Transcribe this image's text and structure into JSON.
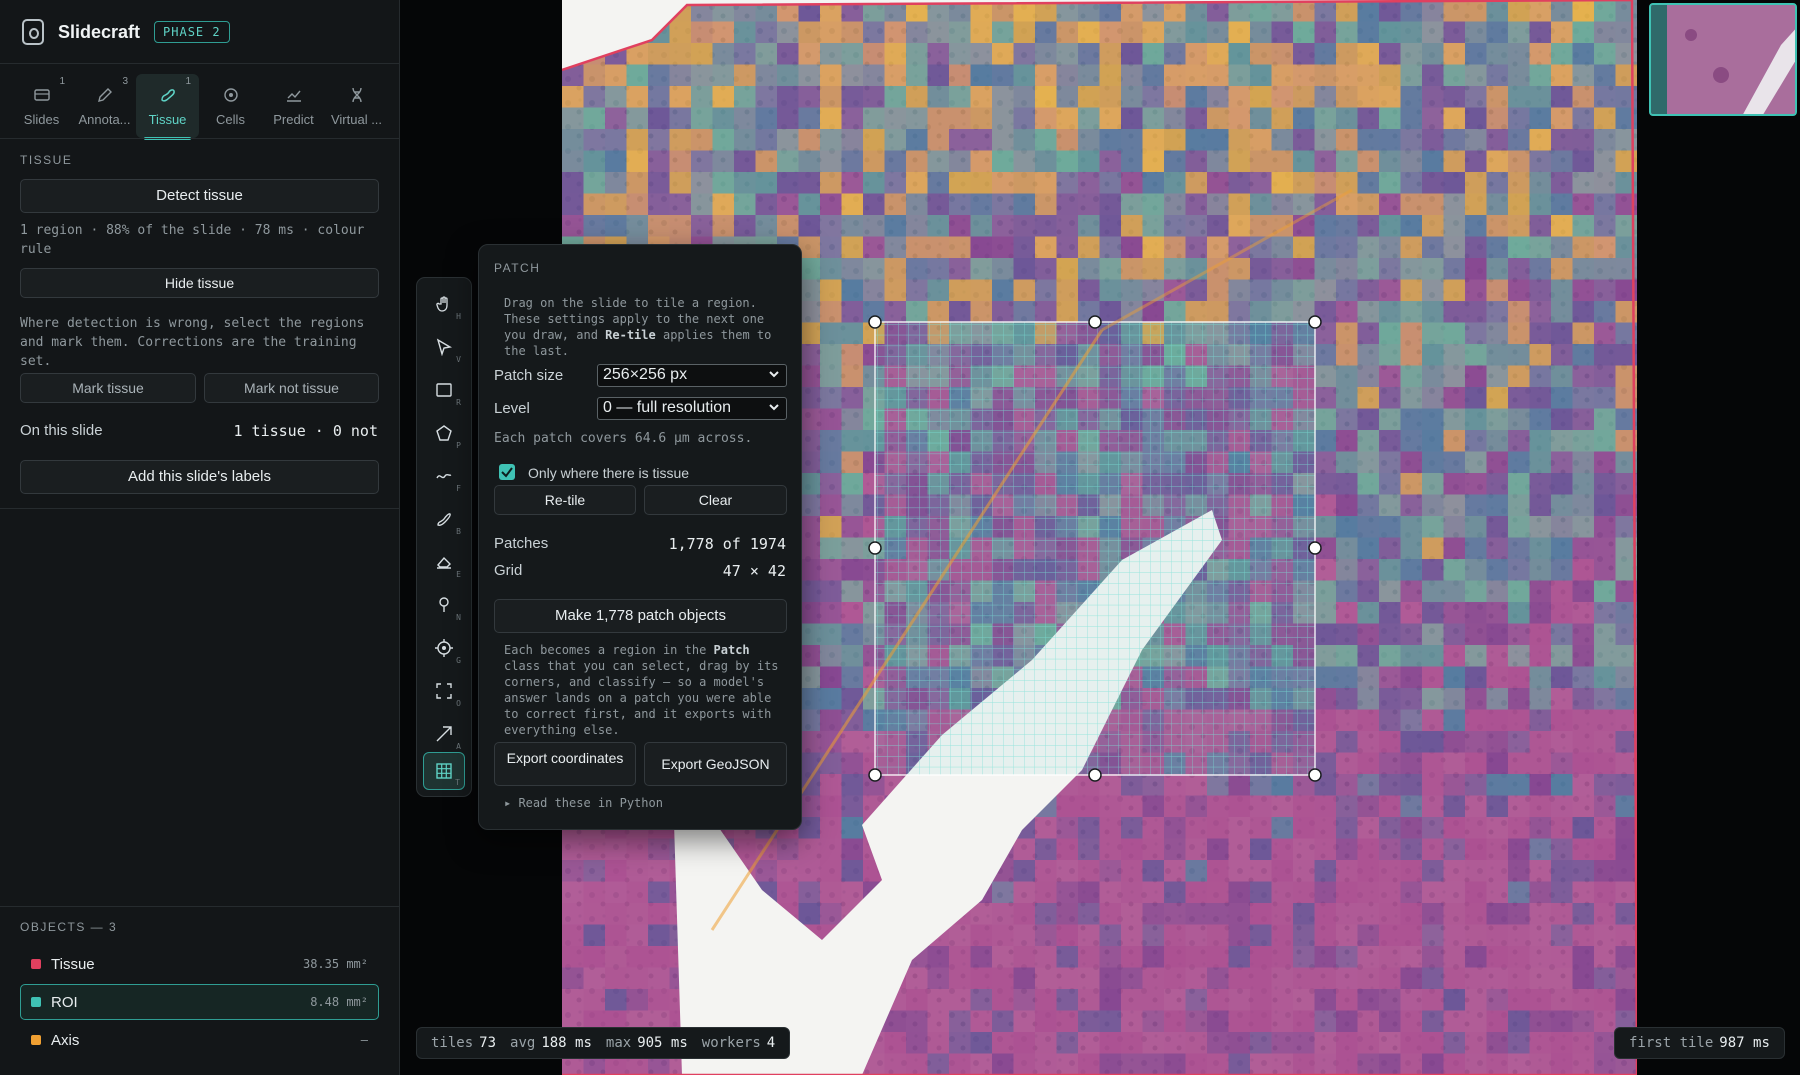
{
  "app": {
    "name": "Slidecraft",
    "phase": "PHASE 2"
  },
  "tabs": [
    {
      "label": "Slides",
      "badge": "1",
      "icon": "slides-icon"
    },
    {
      "label": "Annota...",
      "badge": "3",
      "icon": "pen-icon"
    },
    {
      "label": "Tissue",
      "badge": "1",
      "icon": "tissue-icon",
      "active": true
    },
    {
      "label": "Cells",
      "badge": "",
      "icon": "cell-icon"
    },
    {
      "label": "Predict",
      "badge": "",
      "icon": "chart-icon"
    },
    {
      "label": "Virtual ...",
      "badge": "",
      "icon": "dna-icon"
    }
  ],
  "tissue": {
    "section": "TISSUE",
    "detect_label": "Detect tissue",
    "summary": "1 region · 88% of the slide · 78 ms · colour rule",
    "hide_label": "Hide tissue",
    "help": "Where detection is wrong, select the regions and mark them. Corrections are the training set.",
    "mark_tissue": "Mark tissue",
    "mark_not_tissue": "Mark not tissue",
    "on_slide_label": "On this slide",
    "on_slide_value": "1 tissue · 0 not",
    "add_labels": "Add this slide's labels"
  },
  "objects": {
    "header": "OBJECTS — 3",
    "items": [
      {
        "name": "Tissue",
        "value": "38.35 mm²",
        "color": "#e0405f"
      },
      {
        "name": "ROI",
        "value": "8.48 mm²",
        "color": "#3fc2b4",
        "selected": true
      },
      {
        "name": "Axis",
        "value": "—",
        "color": "#f0a032"
      }
    ]
  },
  "tools": [
    {
      "name": "hand-icon",
      "key": "H"
    },
    {
      "name": "pointer-icon",
      "key": "V"
    },
    {
      "name": "rectangle-icon",
      "key": "R"
    },
    {
      "name": "polygon-icon",
      "key": "P"
    },
    {
      "name": "freehand-icon",
      "key": "F"
    },
    {
      "name": "brush-icon",
      "key": "B"
    },
    {
      "name": "eraser-icon",
      "key": "E"
    },
    {
      "name": "pin-icon",
      "key": "N"
    },
    {
      "name": "crosshair-icon",
      "key": "G"
    },
    {
      "name": "frame-icon",
      "key": "O"
    },
    {
      "name": "arrow-icon",
      "key": "A"
    },
    {
      "name": "grid-icon",
      "key": "T",
      "active": true
    }
  ],
  "patch": {
    "section": "PATCH",
    "intro_1": "Drag on the slide to tile a region. These settings apply to the next one you draw, and",
    "intro_bold": "Re-tile",
    "intro_2": "applies them to the last.",
    "patch_size_label": "Patch size",
    "patch_size_value": "256×256 px",
    "level_label": "Level",
    "level_value": "0 — full resolution",
    "covers": "Each patch covers 64.6 µm across.",
    "only_tissue_label": "Only where there is tissue",
    "retile_label": "Re-tile",
    "clear_label": "Clear",
    "patches_label": "Patches",
    "patches_value": "1,778 of 1974",
    "grid_label": "Grid",
    "grid_value": "47 × 42",
    "make_label": "Make 1,778 patch objects",
    "info_1": "Each becomes a region in the",
    "info_bold": "Patch",
    "info_2": "class that you can select, drag by its corners, and classify — so a model's answer lands on a patch you were able to correct first, and it exports with everything else.",
    "export_coords": "Export coordinates",
    "export_geojson": "Export GeoJSON",
    "python_link": "▸ Read these in Python"
  },
  "status_left": {
    "tiles_label": "tiles",
    "tiles": "73",
    "avg_label": "avg",
    "avg": "188 ms",
    "max_label": "max",
    "max": "905 ms",
    "workers_label": "workers",
    "workers": "4"
  },
  "status_right": {
    "label": "first tile",
    "value": "987 ms"
  }
}
